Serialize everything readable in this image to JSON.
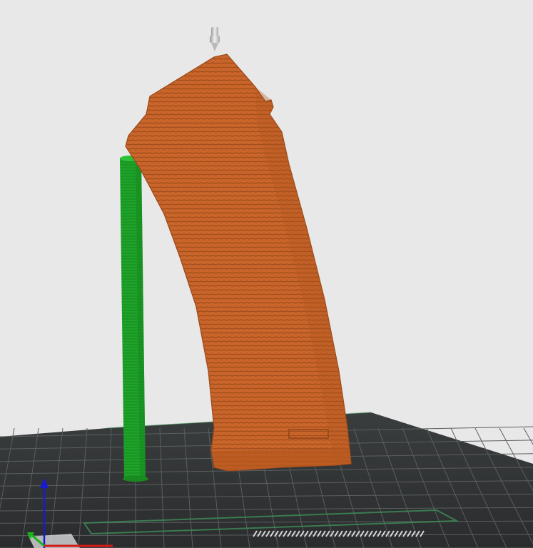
{
  "viewport": {
    "background": "#e8e8e8"
  },
  "bed": {
    "color": "#2f3233",
    "grid_color": "#5b5f60",
    "edge_highlight": "#3e8f5a"
  },
  "model": {
    "color": "#c9652a",
    "shade_color": "#a34d1c",
    "layer_line_color": "#8e4419"
  },
  "support": {
    "color": "#1fa32a",
    "shade_color": "#178a20"
  },
  "nozzle": {
    "color": "#cfcfcf"
  },
  "axes": {
    "x_color": "#d11a1a",
    "y_color": "#1ab51a",
    "z_color": "#1a1ad1",
    "x_icon": "axis-x-arrow-icon",
    "y_icon": "axis-y-arrow-icon",
    "z_icon": "axis-z-arrow-icon"
  },
  "icons": {
    "nozzle": "nozzle-icon"
  }
}
